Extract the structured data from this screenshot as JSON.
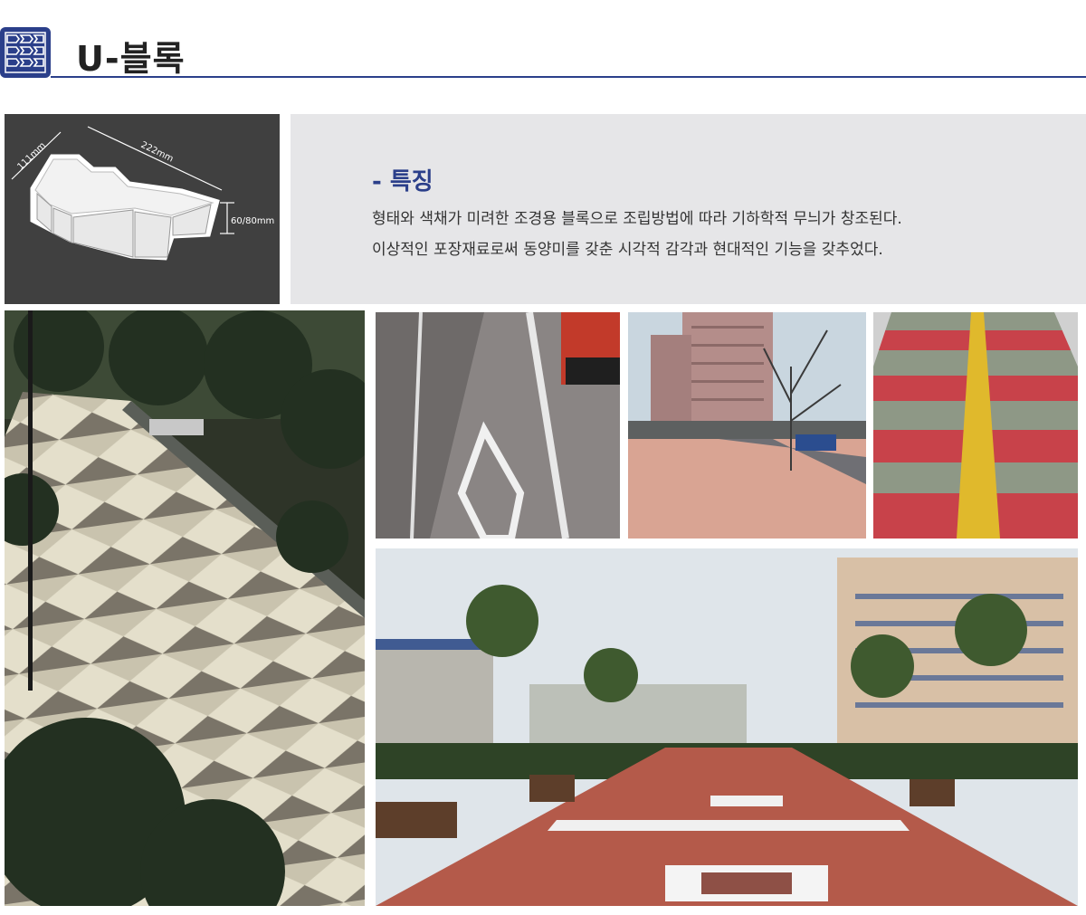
{
  "header": {
    "title": "U-블록",
    "logo_icon": "paving-pattern-icon"
  },
  "diagram": {
    "width_label": "111mm",
    "length_label": "222mm",
    "height_label": "60/80mm"
  },
  "features": {
    "title": "- 특징",
    "lines": [
      "형태와 색채가 미려한 조경용 블록으로 조립방법에 따라 기하학적 무늬가 창조된다.",
      "이상적인 포장재료로써 동양미를 갖춘 시각적 감각과 현대적인 기능을 갖추었다."
    ]
  },
  "colors": {
    "brand": "#2b3f8a",
    "panel_bg": "#e6e6e8",
    "diagram_bg": "#404040"
  }
}
